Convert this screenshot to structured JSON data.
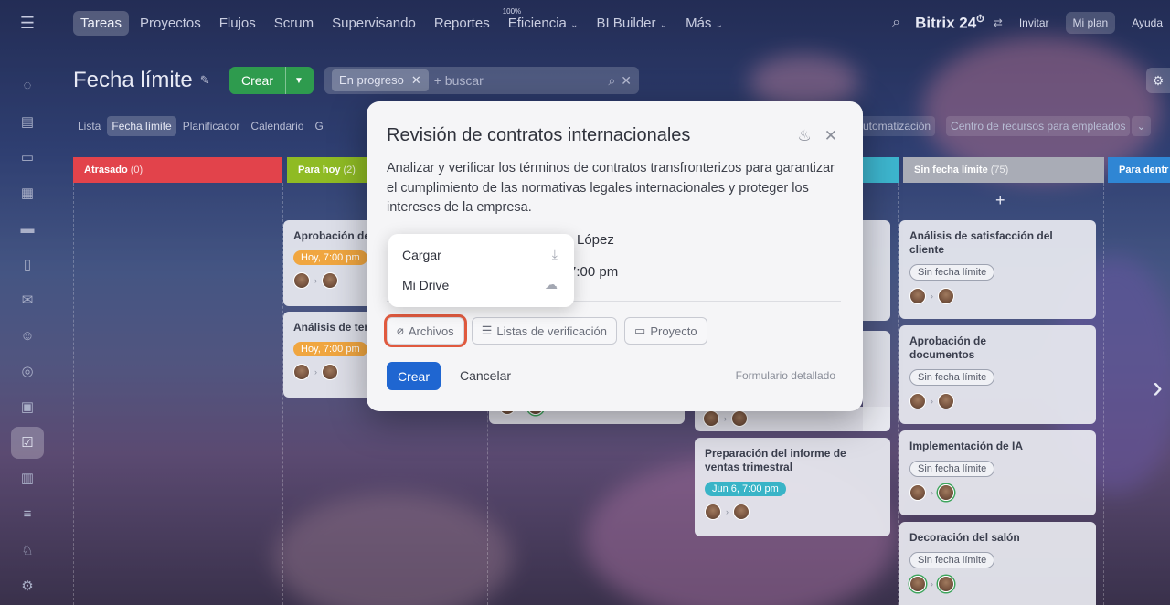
{
  "topbar": {
    "nav": [
      {
        "label": "Tareas",
        "active": true
      },
      {
        "label": "Proyectos"
      },
      {
        "label": "Flujos"
      },
      {
        "label": "Scrum"
      },
      {
        "label": "Supervisando"
      },
      {
        "label": "Reportes"
      },
      {
        "label": "Eficiencia",
        "dropdown": true,
        "badge": "100%"
      },
      {
        "label": "BI Builder",
        "dropdown": true
      },
      {
        "label": "Más",
        "dropdown": true
      }
    ],
    "brand": "Bitrix 24",
    "invite": "Invitar",
    "plan": "Mi plan",
    "help": "Ayuda"
  },
  "header": {
    "title": "Fecha límite",
    "create": "Crear",
    "filter_chip": "En progreso",
    "search_placeholder": "+ buscar"
  },
  "view_tabs": [
    "Lista",
    "Fecha límite",
    "Planificador",
    "Calendario",
    "G"
  ],
  "view_tabs_right": [
    "utomatización",
    "Centro de recursos para empleados"
  ],
  "columns": [
    {
      "title": "Atrasado",
      "count": "(0)",
      "color": "#e2434b"
    },
    {
      "title": "Para hoy",
      "count": "(2)",
      "color": "#8fbb24"
    },
    {
      "title": "Sin fecha límite",
      "count": "(75)",
      "color": "#a9acb6"
    },
    {
      "title": "Para dentr",
      "count": "",
      "color": "#2f86d4"
    }
  ],
  "cards": {
    "today": [
      {
        "title": "Aprobación de",
        "due": "Hoy, 7:00 pm"
      },
      {
        "title": "Análisis de ter",
        "due": "Hoy, 7:00 pm"
      }
    ],
    "week": [
      {
        "title": "Preparación del informe de ventas trimestral",
        "due": "Jun 6, 7:00 pm"
      }
    ],
    "no_deadline": [
      {
        "title": "Análisis de satisfacción del cliente",
        "due": "Sin fecha límite"
      },
      {
        "title": "Aprobación de documentos",
        "due": "Sin fecha límite"
      },
      {
        "title": "Implementación de IA",
        "due": "Sin fecha límite"
      },
      {
        "title": "Decoración del salón",
        "due": "Sin fecha límite"
      }
    ]
  },
  "modal": {
    "title": "Revisión de contratos internacionales",
    "description": "Analizar y verificar los términos de contratos transfronterizos para garantizar el cumplimiento de las normativas legales internacionales y proteger los intereses de la empresa.",
    "responsible_partial": "López",
    "time_partial": "7:00 pm",
    "buttons": {
      "files": "Archivos",
      "checklists": "Listas de verificación",
      "project": "Proyecto"
    },
    "create": "Crear",
    "cancel": "Cancelar",
    "detailed": "Formulario detallado"
  },
  "dropdown": {
    "items": [
      {
        "label": "Cargar",
        "icon": "download-icon"
      },
      {
        "label": "Mi Drive",
        "icon": "cloud-upload-icon"
      }
    ]
  }
}
